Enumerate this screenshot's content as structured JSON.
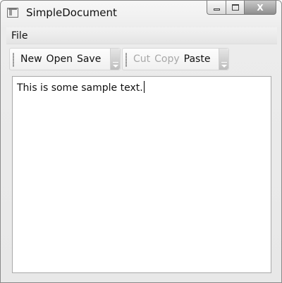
{
  "window": {
    "title": "SimpleDocument",
    "controls": {
      "minimize_icon": "minimize-icon",
      "maximize_icon": "maximize-icon",
      "close_label": "X"
    }
  },
  "menu": {
    "items": [
      {
        "label": "File"
      }
    ]
  },
  "toolbars": [
    {
      "buttons": [
        {
          "label": "New",
          "enabled": true
        },
        {
          "label": "Open",
          "enabled": true
        },
        {
          "label": "Save",
          "enabled": true
        }
      ]
    },
    {
      "buttons": [
        {
          "label": "Cut",
          "enabled": false
        },
        {
          "label": "Copy",
          "enabled": false
        },
        {
          "label": "Paste",
          "enabled": true
        }
      ]
    }
  ],
  "editor": {
    "text": "This is some sample text."
  },
  "colors": {
    "disabled_text": "#a8a8a8",
    "window_frame": "#e8e8e8"
  }
}
